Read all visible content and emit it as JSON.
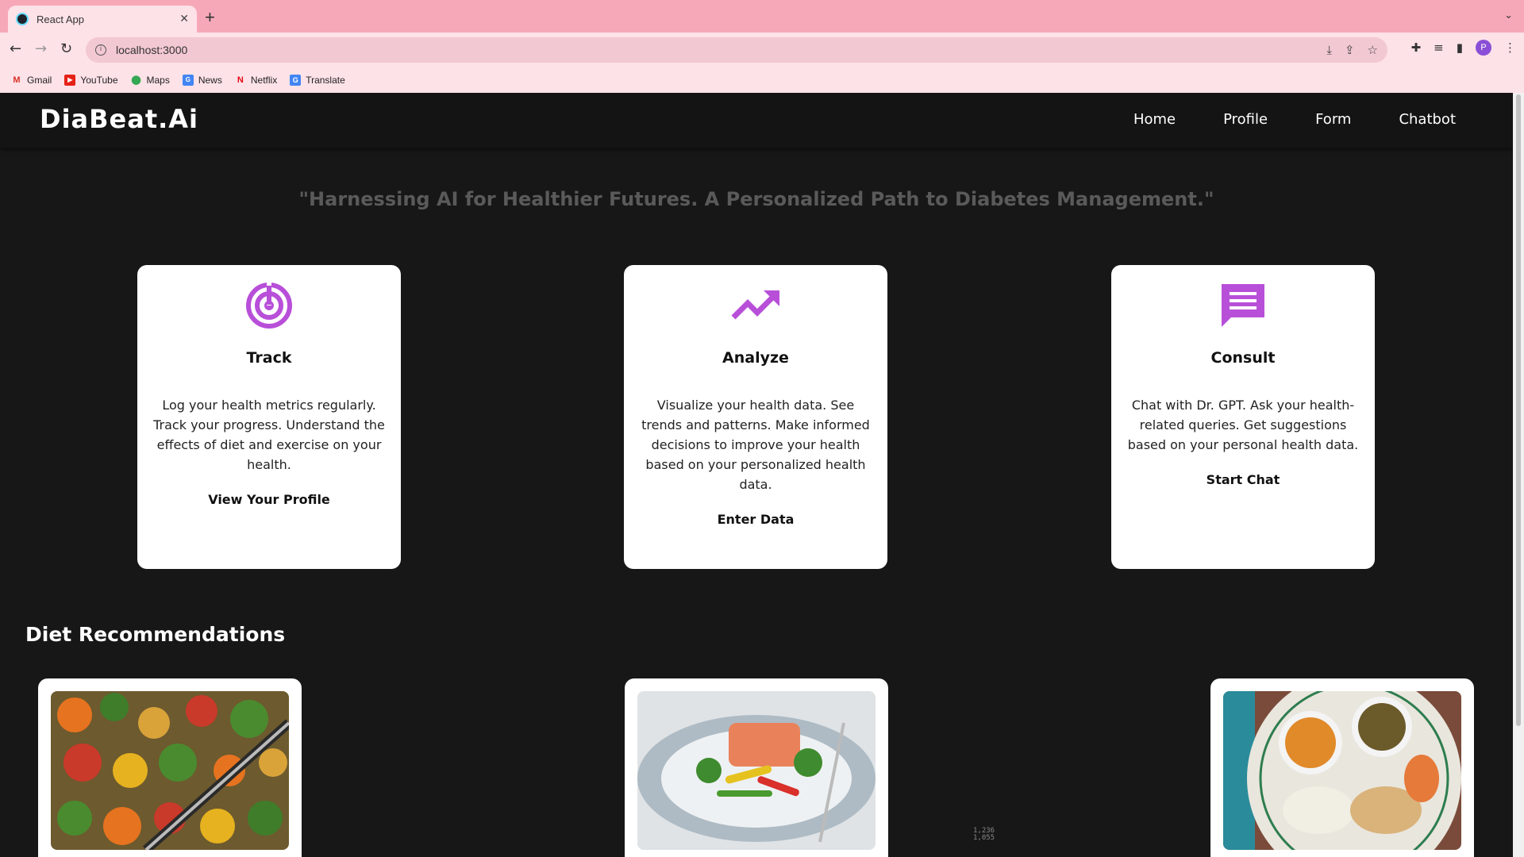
{
  "browser": {
    "tab_title": "React App",
    "url": "localhost:3000",
    "bookmarks": [
      "Gmail",
      "YouTube",
      "Maps",
      "News",
      "Netflix",
      "Translate"
    ],
    "profile_initial": "P"
  },
  "navbar": {
    "brand": "DiaBeat.Ai",
    "links": [
      "Home",
      "Profile",
      "Form",
      "Chatbot"
    ]
  },
  "tagline": "\"Harnessing AI for Healthier Futures. A Personalized Path to Diabetes Management.\"",
  "features": [
    {
      "icon": "target-icon",
      "title": "Track",
      "text": "Log your health metrics regularly. Track your progress. Understand the effects of diet and exercise on your health.",
      "action": "View Your Profile"
    },
    {
      "icon": "trending-up-icon",
      "title": "Analyze",
      "text": "Visualize your health data. See trends and patterns. Make informed decisions to improve your health based on your personalized health data.",
      "action": "Enter Data"
    },
    {
      "icon": "chat-icon",
      "title": "Consult",
      "text": "Chat with Dr. GPT. Ask your health-related queries. Get suggestions based on your personal health data.",
      "action": "Start Chat"
    }
  ],
  "diet": {
    "title": "Diet Recommendations",
    "items": [
      "roasted-vegetables-photo",
      "salmon-vegetables-photo",
      "indian-thali-photo"
    ]
  },
  "cursor_readout": [
    "1,236",
    "1,055"
  ],
  "colors": {
    "accent": "#b84fd9",
    "page_bg": "#171717",
    "navbar_bg": "#141414"
  }
}
